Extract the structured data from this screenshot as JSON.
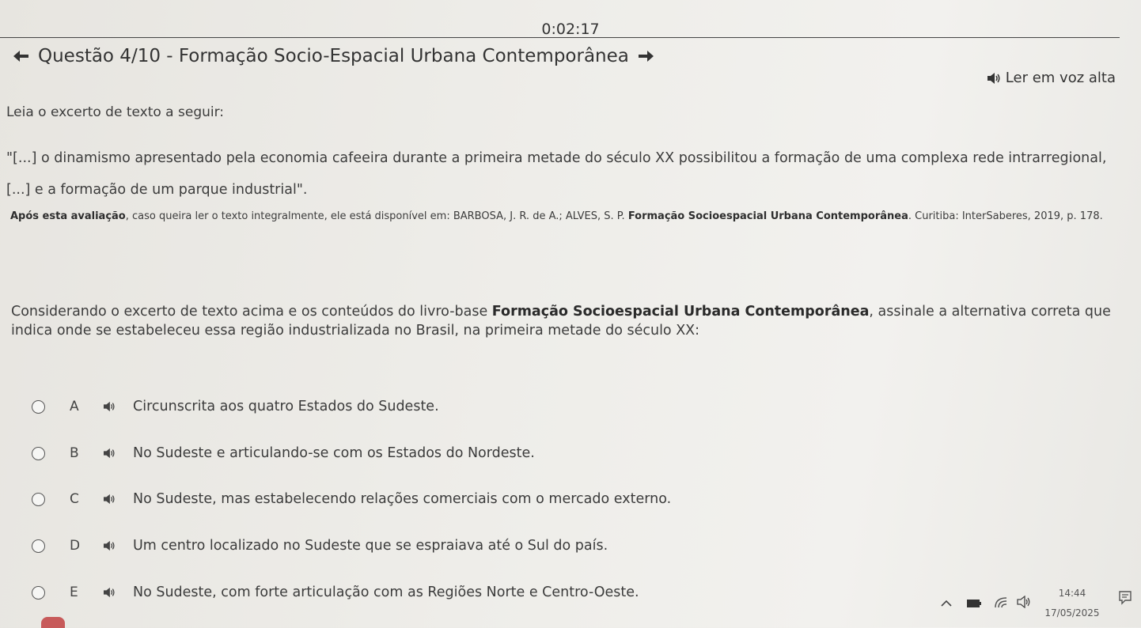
{
  "timer": "0:02:17",
  "header": {
    "title": "Questão 4/10 - Formação Socio-Espacial Urbana Contemporânea",
    "read_aloud_label": "Ler em voz alta"
  },
  "content": {
    "intro": "Leia o excerto de texto a seguir:",
    "quote": "\"[...] o dinamismo apresentado pela economia cafeeira durante a primeira metade do século XX possibilitou a formação de uma complexa rede intrarregional, [...] e a formação de um parque industrial\".",
    "source_bold": "Após esta avaliação",
    "source_text": ", caso queira ler o texto integralmente, ele está disponível em: BARBOSA, J. R. de A.; ALVES, S. P. ",
    "source_book": "Formação Socioespacial Urbana Contemporânea",
    "source_end": ". Curitiba: InterSaberes, 2019, p. 178.",
    "question_start": "Considerando o excerto de texto acima e os conteúdos do livro-base ",
    "question_book": "Formação Socioespacial Urbana Contemporânea",
    "question_end": ", assinale a alternativa correta que indica onde se estabeleceu essa região industrializada no Brasil, na primeira metade do século XX:"
  },
  "options": [
    {
      "letter": "A",
      "text": "Circunscrita aos quatro Estados do Sudeste."
    },
    {
      "letter": "B",
      "text": "No Sudeste e articulando-se com os Estados do Nordeste."
    },
    {
      "letter": "C",
      "text": "No Sudeste, mas estabelecendo relações comerciais com o mercado externo."
    },
    {
      "letter": "D",
      "text": "Um centro localizado no Sudeste que se espraiava até o Sul do país."
    },
    {
      "letter": "E",
      "text": "No Sudeste, com forte articulação com as Regiões Norte e Centro-Oeste."
    }
  ],
  "taskbar": {
    "time": "14:44",
    "date": "17/05/2025"
  }
}
